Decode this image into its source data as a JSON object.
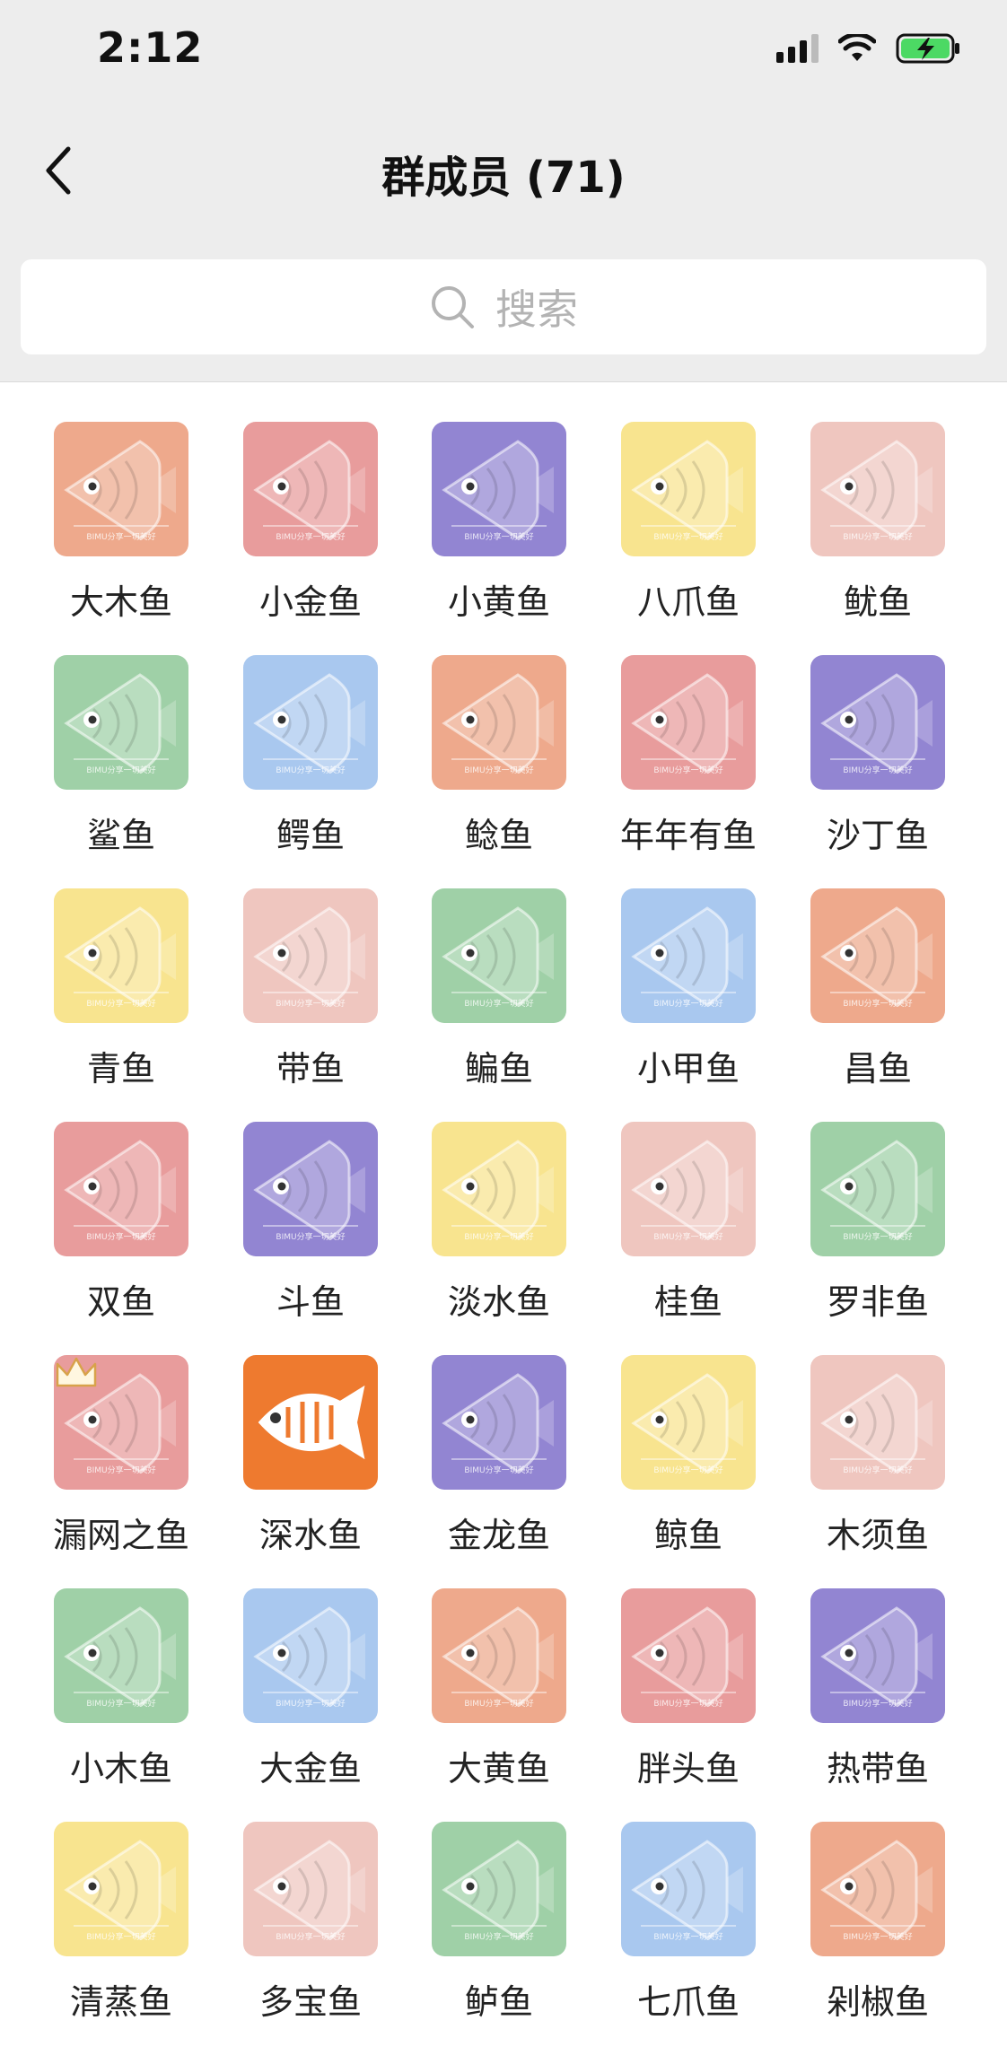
{
  "status_bar": {
    "time": "2:12"
  },
  "nav": {
    "title": "群成员 (71)"
  },
  "search": {
    "placeholder": "搜索"
  },
  "avatar_watermark": "BIMU分享一切美好",
  "colors": {
    "orange": "#eea98c",
    "red": "#e89c9c",
    "purple": "#9285d2",
    "yellow": "#f8e48f",
    "pink": "#efc6bf",
    "green": "#9fd0a7",
    "blue": "#a9c8ef",
    "deep_orange": "#ee7a2f"
  },
  "members": [
    {
      "name": "大木鱼",
      "color": "orange"
    },
    {
      "name": "小金鱼",
      "color": "red"
    },
    {
      "name": "小黄鱼",
      "color": "purple"
    },
    {
      "name": "八爪鱼",
      "color": "yellow"
    },
    {
      "name": "鱿鱼",
      "color": "pink"
    },
    {
      "name": "鲨鱼",
      "color": "green"
    },
    {
      "name": "鳄鱼",
      "color": "blue"
    },
    {
      "name": "鲶鱼",
      "color": "orange"
    },
    {
      "name": "年年有鱼",
      "color": "red"
    },
    {
      "name": "沙丁鱼",
      "color": "purple"
    },
    {
      "name": "青鱼",
      "color": "yellow"
    },
    {
      "name": "带鱼",
      "color": "pink"
    },
    {
      "name": "鳊鱼",
      "color": "green"
    },
    {
      "name": "小甲鱼",
      "color": "blue"
    },
    {
      "name": "昌鱼",
      "color": "orange"
    },
    {
      "name": "双鱼",
      "color": "red"
    },
    {
      "name": "斗鱼",
      "color": "purple"
    },
    {
      "name": "淡水鱼",
      "color": "yellow"
    },
    {
      "name": "桂鱼",
      "color": "pink"
    },
    {
      "name": "罗非鱼",
      "color": "green"
    },
    {
      "name": "漏网之鱼",
      "color": "red",
      "crown": true
    },
    {
      "name": "深水鱼",
      "color": "deep_orange",
      "special": true
    },
    {
      "name": "金龙鱼",
      "color": "purple"
    },
    {
      "name": "鲸鱼",
      "color": "yellow"
    },
    {
      "name": "木须鱼",
      "color": "pink"
    },
    {
      "name": "小木鱼",
      "color": "green"
    },
    {
      "name": "大金鱼",
      "color": "blue"
    },
    {
      "name": "大黄鱼",
      "color": "orange"
    },
    {
      "name": "胖头鱼",
      "color": "red"
    },
    {
      "name": "热带鱼",
      "color": "purple"
    },
    {
      "name": "清蒸鱼",
      "color": "yellow"
    },
    {
      "name": "多宝鱼",
      "color": "pink"
    },
    {
      "name": "鲈鱼",
      "color": "green"
    },
    {
      "name": "七爪鱼",
      "color": "blue"
    },
    {
      "name": "剁椒鱼",
      "color": "orange"
    }
  ]
}
